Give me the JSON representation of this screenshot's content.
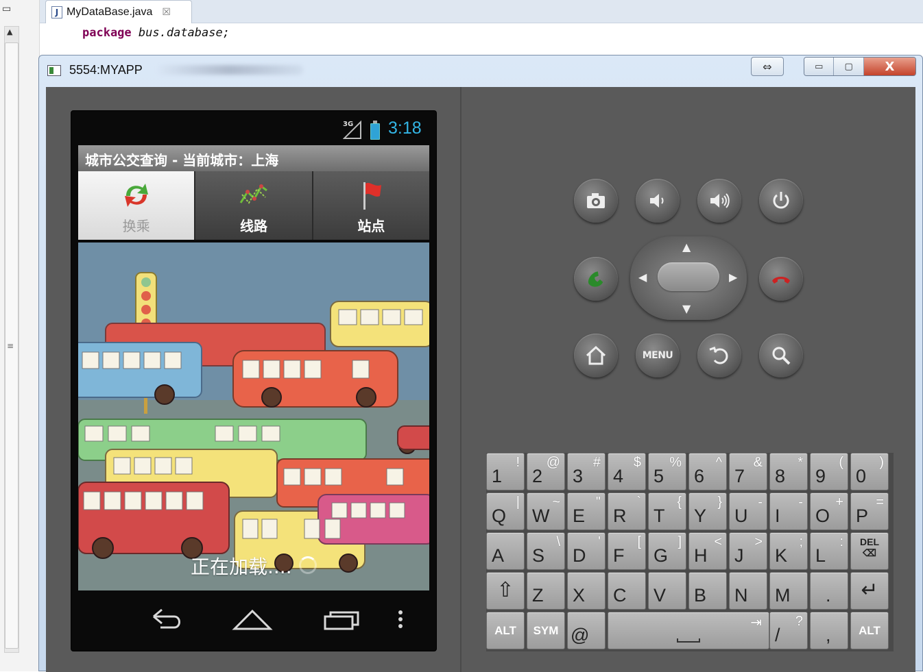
{
  "ide": {
    "tab": {
      "icon_letter": "J",
      "filename": "MyDataBase.java",
      "close_glyph": "☒"
    },
    "code": {
      "keyword": "package",
      "identifier": "bus.database;"
    }
  },
  "emulator": {
    "title": "5554:MYAPP",
    "controls": {
      "resize": "⇔",
      "minimize": "▭",
      "maximize": "▢",
      "close": "X"
    }
  },
  "device": {
    "status": {
      "network": "3G",
      "time": "3:18"
    },
    "app_title": "城市公交查询 - 当前城市：上海",
    "tabs": [
      {
        "label": "换乘",
        "active": true
      },
      {
        "label": "线路",
        "active": false
      },
      {
        "label": "站点",
        "active": false
      }
    ],
    "loading_text": "正在加载....",
    "nav": [
      "back-icon",
      "home-icon",
      "recent-apps-icon",
      "overflow-menu-icon"
    ]
  },
  "hardware": {
    "row1": [
      "camera-icon",
      "volume-down-icon",
      "volume-up-icon",
      "power-icon"
    ],
    "row2": [
      "call-icon",
      "dpad",
      "end-call-icon"
    ],
    "row3": [
      "home-icon",
      "menu-button",
      "back-icon",
      "search-icon"
    ],
    "menu_label": "MENU"
  },
  "keyboard": {
    "rows": [
      [
        [
          "1",
          "!"
        ],
        [
          "2",
          "@"
        ],
        [
          "3",
          "#"
        ],
        [
          "4",
          "$"
        ],
        [
          "5",
          "%"
        ],
        [
          "6",
          "^"
        ],
        [
          "7",
          "&"
        ],
        [
          "8",
          "*"
        ],
        [
          "9",
          "("
        ],
        [
          "0",
          ")"
        ]
      ],
      [
        [
          "Q",
          "|"
        ],
        [
          "W",
          "~"
        ],
        [
          "E",
          "\""
        ],
        [
          "R",
          "`"
        ],
        [
          "T",
          "{"
        ],
        [
          "Y",
          "}"
        ],
        [
          "U",
          "-"
        ],
        [
          "I",
          "-"
        ],
        [
          "O",
          "+"
        ],
        [
          "P",
          "="
        ]
      ],
      [
        [
          "A",
          ""
        ],
        [
          "S",
          "\\"
        ],
        [
          "D",
          "'"
        ],
        [
          "F",
          "["
        ],
        [
          "G",
          "]"
        ],
        [
          "H",
          "<"
        ],
        [
          "J",
          ">"
        ],
        [
          "K",
          ";"
        ],
        [
          "L",
          ":"
        ]
      ],
      [
        [
          "Z",
          ""
        ],
        [
          "X",
          ""
        ],
        [
          "C",
          ""
        ],
        [
          "V",
          ""
        ],
        [
          "B",
          ""
        ],
        [
          "N",
          ""
        ],
        [
          "M",
          ""
        ],
        [
          ".",
          ""
        ]
      ],
      [
        [
          "/",
          "?"
        ],
        [
          ",",
          ""
        ]
      ]
    ],
    "special": {
      "del": "DEL",
      "alt": "ALT",
      "sym": "SYM",
      "at": "@",
      "shift": "⇧",
      "enter": "↵",
      "space_tab": "⇥"
    }
  },
  "colors": {
    "clock": "#33b5e5",
    "call_green": "#2a8a2a",
    "end_call_red": "#cc2222",
    "keyword": "#7f0055"
  }
}
